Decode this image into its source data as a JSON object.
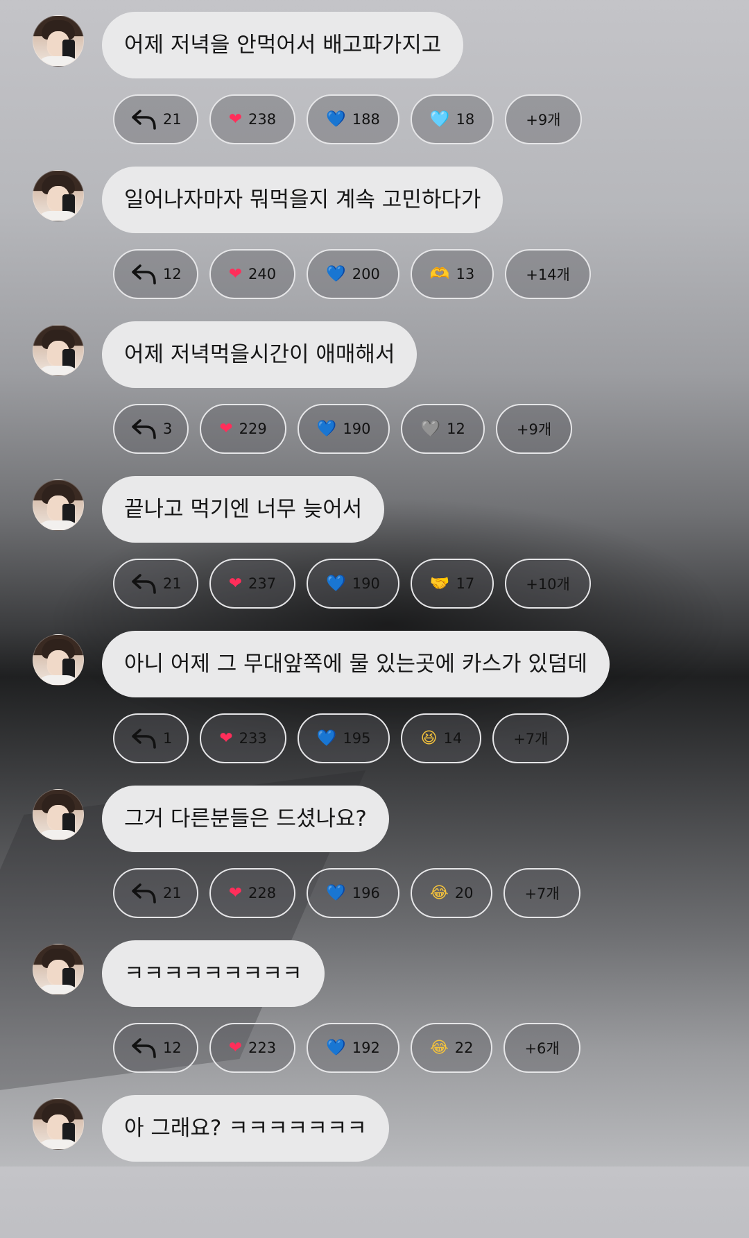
{
  "messages": [
    {
      "text": "어제 저녁을 안먹어서 배고파가지고",
      "reactions": [
        {
          "type": "reply",
          "count": "21"
        },
        {
          "emoji": "❤",
          "emoji_name": "red-heart-icon",
          "count": "238",
          "color": "#ff2e5a"
        },
        {
          "emoji": "💙",
          "emoji_name": "blue-heart-icon",
          "count": "188",
          "color": "#1f8dff"
        },
        {
          "emoji": "🩵",
          "emoji_name": "light-blue-heart-icon",
          "count": "18",
          "color": "#31d8ff"
        }
      ],
      "more": "+9개"
    },
    {
      "text": "일어나자마자 뭐먹을지 계속 고민하다가",
      "reactions": [
        {
          "type": "reply",
          "count": "12"
        },
        {
          "emoji": "❤",
          "emoji_name": "red-heart-icon",
          "count": "240",
          "color": "#ff2e5a"
        },
        {
          "emoji": "💙",
          "emoji_name": "blue-heart-icon",
          "count": "200",
          "color": "#1f8dff"
        },
        {
          "emoji": "🫶",
          "emoji_name": "heart-hands-icon",
          "count": "13",
          "color": "#f4b740"
        }
      ],
      "more": "+14개"
    },
    {
      "text": "어제 저녁먹을시간이 애매해서",
      "reactions": [
        {
          "type": "reply",
          "count": "3"
        },
        {
          "emoji": "❤",
          "emoji_name": "red-heart-icon",
          "count": "229",
          "color": "#ff2e5a"
        },
        {
          "emoji": "💙",
          "emoji_name": "blue-heart-icon",
          "count": "190",
          "color": "#1f8dff"
        },
        {
          "emoji": "🩶",
          "emoji_name": "grey-heart-icon",
          "count": "12",
          "color": "#c9c9cc"
        }
      ],
      "more": "+9개"
    },
    {
      "text": "끝나고 먹기엔 너무 늦어서",
      "reactions": [
        {
          "type": "reply",
          "count": "21"
        },
        {
          "emoji": "❤",
          "emoji_name": "red-heart-icon",
          "count": "237",
          "color": "#ff2e5a"
        },
        {
          "emoji": "💙",
          "emoji_name": "blue-heart-icon",
          "count": "190",
          "color": "#1f8dff"
        },
        {
          "emoji": "🤝",
          "emoji_name": "handshake-icon",
          "count": "17",
          "color": "#f1b338"
        }
      ],
      "more": "+10개"
    },
    {
      "text": "아니 어제 그 무대앞쪽에 물 있는곳에 카스가 있덤데",
      "reactions": [
        {
          "type": "reply",
          "count": "1"
        },
        {
          "emoji": "❤",
          "emoji_name": "red-heart-icon",
          "count": "233",
          "color": "#ff2e5a"
        },
        {
          "emoji": "💙",
          "emoji_name": "blue-heart-icon",
          "count": "195",
          "color": "#1f8dff"
        },
        {
          "emoji": "😆",
          "emoji_name": "grinning-squint-icon",
          "count": "14",
          "color": "#f5c33b"
        }
      ],
      "more": "+7개"
    },
    {
      "text": "그거 다른분들은 드셨나요?",
      "reactions": [
        {
          "type": "reply",
          "count": "21"
        },
        {
          "emoji": "❤",
          "emoji_name": "red-heart-icon",
          "count": "228",
          "color": "#ff2e5a"
        },
        {
          "emoji": "💙",
          "emoji_name": "blue-heart-icon",
          "count": "196",
          "color": "#1f8dff"
        },
        {
          "emoji": "😂",
          "emoji_name": "tears-of-joy-icon",
          "count": "20",
          "color": "#f5c33b"
        }
      ],
      "more": "+7개"
    },
    {
      "text": "ㅋㅋㅋㅋㅋㅋㅋㅋㅋ",
      "reactions": [
        {
          "type": "reply",
          "count": "12"
        },
        {
          "emoji": "❤",
          "emoji_name": "red-heart-icon",
          "count": "223",
          "color": "#ff2e5a"
        },
        {
          "emoji": "💙",
          "emoji_name": "blue-heart-icon",
          "count": "192",
          "color": "#1f8dff"
        },
        {
          "emoji": "😂",
          "emoji_name": "tears-of-joy-icon",
          "count": "22",
          "color": "#f5c33b"
        }
      ],
      "more": "+6개"
    },
    {
      "text": "아 그래요? ㅋㅋㅋㅋㅋㅋㅋ",
      "reactions": [],
      "more": ""
    }
  ]
}
